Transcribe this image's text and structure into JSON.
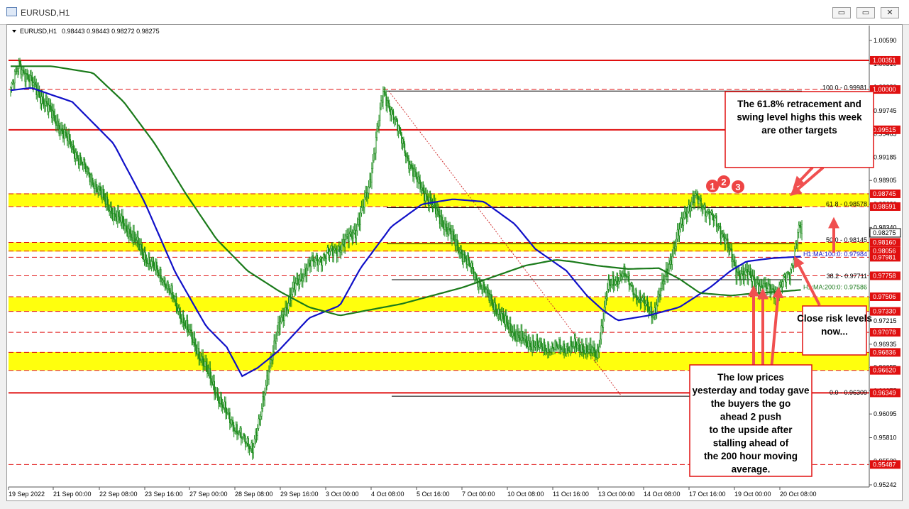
{
  "window": {
    "title": "EURUSD,H1",
    "buttons": {
      "minimize": "▭",
      "restore": "▭",
      "close": "✕"
    }
  },
  "chart_data": {
    "type": "candlestick",
    "symbol_label": "EURUSD,H1",
    "ohlc_header": "0.98443 0.98443 0.98272 0.98275",
    "ylim": [
      0.95242,
      1.0059
    ],
    "y_tick_labels": [
      "1.00590",
      "1.00310",
      "1.00030",
      "0.99745",
      "0.99465",
      "0.99185",
      "0.98905",
      "0.98620",
      "0.98340",
      "0.98060",
      "0.97780",
      "0.97500",
      "0.97215",
      "0.96935",
      "0.96655",
      "0.96375",
      "0.96095",
      "0.95810",
      "0.95530",
      "0.95242"
    ],
    "x_tick_labels": [
      "19 Sep 2022",
      "21 Sep 00:00",
      "22 Sep 08:00",
      "23 Sep 16:00",
      "27 Sep 00:00",
      "28 Sep 08:00",
      "29 Sep 16:00",
      "3 Oct 00:00",
      "4 Oct 08:00",
      "5 Oct 16:00",
      "7 Oct 00:00",
      "10 Oct 08:00",
      "11 Oct 16:00",
      "13 Oct 00:00",
      "14 Oct 08:00",
      "17 Oct 16:00",
      "19 Oct 00:00",
      "20 Oct 08:00"
    ],
    "price_key": [
      [
        0,
        1.0
      ],
      [
        8,
        1.003
      ],
      [
        25,
        1.0
      ],
      [
        45,
        0.996
      ],
      [
        60,
        0.993
      ],
      [
        80,
        0.989
      ],
      [
        100,
        0.985
      ],
      [
        115,
        0.983
      ],
      [
        130,
        0.98
      ],
      [
        150,
        0.977
      ],
      [
        165,
        0.973
      ],
      [
        180,
        0.969
      ],
      [
        195,
        0.965
      ],
      [
        205,
        0.962
      ],
      [
        215,
        0.96
      ],
      [
        225,
        0.958
      ],
      [
        235,
        0.957
      ],
      [
        242,
        0.96
      ],
      [
        250,
        0.966
      ],
      [
        262,
        0.972
      ],
      [
        275,
        0.976
      ],
      [
        290,
        0.979
      ],
      [
        305,
        0.98
      ],
      [
        320,
        0.981
      ],
      [
        335,
        0.983
      ],
      [
        348,
        0.988
      ],
      [
        356,
        0.995
      ],
      [
        362,
        0.9995
      ],
      [
        372,
        0.997
      ],
      [
        385,
        0.992
      ],
      [
        395,
        0.989
      ],
      [
        405,
        0.987
      ],
      [
        420,
        0.984
      ],
      [
        435,
        0.981
      ],
      [
        450,
        0.978
      ],
      [
        465,
        0.975
      ],
      [
        480,
        0.972
      ],
      [
        495,
        0.97
      ],
      [
        515,
        0.969
      ],
      [
        535,
        0.969
      ],
      [
        555,
        0.969
      ],
      [
        570,
        0.968
      ],
      [
        580,
        0.976
      ],
      [
        595,
        0.978
      ],
      [
        610,
        0.975
      ],
      [
        625,
        0.973
      ],
      [
        640,
        0.979
      ],
      [
        655,
        0.985
      ],
      [
        665,
        0.987
      ],
      [
        680,
        0.985
      ],
      [
        695,
        0.982
      ],
      [
        705,
        0.978
      ],
      [
        715,
        0.9778
      ],
      [
        730,
        0.9762
      ],
      [
        745,
        0.9758
      ],
      [
        758,
        0.9782
      ],
      [
        766,
        0.9832
      ],
      [
        770,
        0.983
      ]
    ],
    "moving_averages": [
      {
        "name": "H1:MA:100:0: 0.97984",
        "value": 0.97984,
        "color": "#1010c8",
        "key": [
          [
            0,
            0.9999
          ],
          [
            20,
            1.0002
          ],
          [
            60,
            0.9985
          ],
          [
            100,
            0.9935
          ],
          [
            130,
            0.9865
          ],
          [
            160,
            0.978
          ],
          [
            190,
            0.9715
          ],
          [
            210,
            0.969
          ],
          [
            225,
            0.9655
          ],
          [
            240,
            0.9665
          ],
          [
            260,
            0.9685
          ],
          [
            290,
            0.9725
          ],
          [
            320,
            0.974
          ],
          [
            340,
            0.9785
          ],
          [
            370,
            0.9835
          ],
          [
            400,
            0.9862
          ],
          [
            430,
            0.9868
          ],
          [
            460,
            0.9865
          ],
          [
            490,
            0.9838
          ],
          [
            510,
            0.9808
          ],
          [
            540,
            0.9782
          ],
          [
            560,
            0.9752
          ],
          [
            575,
            0.9735
          ],
          [
            590,
            0.9722
          ],
          [
            620,
            0.9728
          ],
          [
            650,
            0.9738
          ],
          [
            680,
            0.9762
          ],
          [
            700,
            0.9782
          ],
          [
            715,
            0.9793
          ],
          [
            740,
            0.9797
          ],
          [
            770,
            0.9799
          ]
        ]
      },
      {
        "name": "H1:MA:200:0: 0.97586",
        "value": 0.97586,
        "color": "#1a7a1a",
        "key": [
          [
            0,
            1.0028
          ],
          [
            40,
            1.0028
          ],
          [
            80,
            1.002
          ],
          [
            110,
            0.9985
          ],
          [
            140,
            0.9935
          ],
          [
            170,
            0.9875
          ],
          [
            200,
            0.982
          ],
          [
            230,
            0.9782
          ],
          [
            260,
            0.9758
          ],
          [
            290,
            0.9738
          ],
          [
            320,
            0.9728
          ],
          [
            350,
            0.9735
          ],
          [
            380,
            0.9742
          ],
          [
            410,
            0.9752
          ],
          [
            440,
            0.9762
          ],
          [
            470,
            0.9775
          ],
          [
            500,
            0.9788
          ],
          [
            530,
            0.9795
          ],
          [
            545,
            0.9793
          ],
          [
            570,
            0.9788
          ],
          [
            600,
            0.9784
          ],
          [
            630,
            0.9785
          ],
          [
            650,
            0.9772
          ],
          [
            670,
            0.9755
          ],
          [
            700,
            0.9752
          ],
          [
            725,
            0.9755
          ],
          [
            750,
            0.9757
          ],
          [
            770,
            0.9759
          ]
        ]
      }
    ],
    "fib_labels": [
      {
        "label": "100.0 - 0.99981",
        "value": 0.99981
      },
      {
        "label": "61.8 - 0.98578",
        "value": 0.98578
      },
      {
        "label": "50.0 - 0.98145",
        "value": 0.98145
      },
      {
        "label": "38.2 - 0.97711",
        "value": 0.97711
      },
      {
        "label": "0.0 - 0.96309",
        "value": 0.96309
      }
    ],
    "horizontal_levels": [
      {
        "label": "1.00351",
        "value": 1.00351,
        "style": "solid-red"
      },
      {
        "label": "1.00000",
        "value": 1.0,
        "style": "dash-red"
      },
      {
        "label": "0.99515",
        "value": 0.99515,
        "style": "solid-red"
      },
      {
        "label": "0.98745",
        "value": 0.98745,
        "style": "dash-red"
      },
      {
        "label": "0.98591",
        "value": 0.98591,
        "style": "dash-red"
      },
      {
        "label": "0.98160",
        "value": 0.9816,
        "style": "dash-red"
      },
      {
        "label": "0.98056",
        "value": 0.98056,
        "style": "dash-red"
      },
      {
        "label": "0.97981",
        "value": 0.97981,
        "style": "dash-red"
      },
      {
        "label": "0.97758",
        "value": 0.97758,
        "style": "dash-red"
      },
      {
        "label": "0.97506",
        "value": 0.97506,
        "style": "dash-red"
      },
      {
        "label": "0.97330",
        "value": 0.9733,
        "style": "dash-red"
      },
      {
        "label": "0.97078",
        "value": 0.97078,
        "style": "dash-red"
      },
      {
        "label": "0.96836",
        "value": 0.96836,
        "style": "dash-red"
      },
      {
        "label": "0.96620",
        "value": 0.9662,
        "style": "dash-red"
      },
      {
        "label": "0.96349",
        "value": 0.96349,
        "style": "solid-red"
      },
      {
        "label": "0.95487",
        "value": 0.95487,
        "style": "dash-red"
      }
    ],
    "current_price": {
      "label": "0.98275",
      "value": 0.98275
    },
    "support_zones": [
      [
        0.9859,
        0.9875
      ],
      [
        0.9805,
        0.9816
      ],
      [
        0.9733,
        0.975
      ],
      [
        0.9662,
        0.9684
      ]
    ],
    "swing_markers": [
      "1",
      "2",
      "3"
    ],
    "annotations": [
      {
        "name": "targets-note",
        "text": "The 61.8% retracement and swing level highs this week are other targets"
      },
      {
        "name": "risk-note",
        "text": "Close risk levels now..."
      },
      {
        "name": "buyers-note",
        "text": "The low prices yesterday and today gave the buyers the go ahead 2 push to the upside after stalling ahead of the 200 hour moving average."
      }
    ],
    "colors": {
      "candle": "#1a8a1a",
      "ma100": "#1010c8",
      "ma200": "#1a7a1a",
      "zone": "#ffff00",
      "level": "#e01010",
      "arrow": "#f05050",
      "annotation_border": "#e01010"
    }
  }
}
